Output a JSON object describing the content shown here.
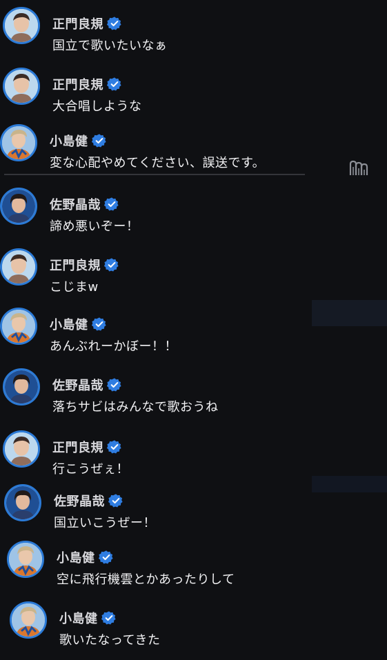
{
  "messages": [
    {
      "name": "正門良規",
      "text": "国立で歌いたいなぁ",
      "avatar": "avatar-masakado"
    },
    {
      "name": "正門良規",
      "text": "大合唱しような",
      "avatar": "avatar-masakado"
    },
    {
      "name": "小島健",
      "text": "変な心配やめてください、誤送です。",
      "avatar": "avatar-kojima"
    },
    {
      "name": "佐野晶哉",
      "text": "諦め悪いぞー！",
      "avatar": "avatar-sano"
    },
    {
      "name": "正門良規",
      "text": "こじまw",
      "avatar": "avatar-masakado"
    },
    {
      "name": "小島健",
      "text": "あんぶれーかぼー！！",
      "avatar": "avatar-kojima"
    },
    {
      "name": "佐野晶哉",
      "text": "落ちサビはみんなで歌おうね",
      "avatar": "avatar-sano"
    },
    {
      "name": "正門良規",
      "text": "行こうぜぇ！",
      "avatar": "avatar-masakado"
    },
    {
      "name": "佐野晶哉",
      "text": "国立いこうぜー！",
      "avatar": "avatar-sano"
    },
    {
      "name": "小島健",
      "text": "空に飛行機雲とかあったりして",
      "avatar": "avatar-kojima"
    },
    {
      "name": "小島健",
      "text": "歌いたなってきた",
      "avatar": "avatar-kojima"
    }
  ],
  "icons": {
    "verified": "verified-check-icon",
    "side": "page-curl-icon"
  },
  "colors": {
    "background": "#0f1013",
    "verified_badge": "#2f7de1",
    "avatar_ring": "#2b7ad6",
    "name_text": "#d8d8dc",
    "message_text": "#f2f2f4"
  }
}
